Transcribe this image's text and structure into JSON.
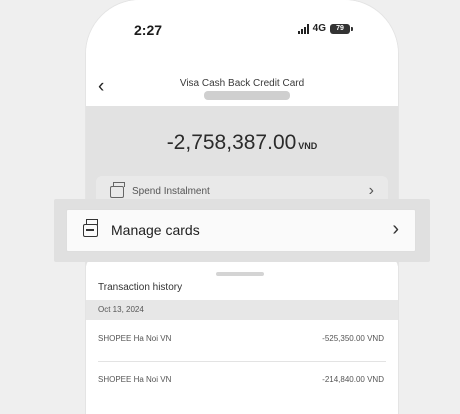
{
  "status_bar": {
    "time": "2:27",
    "network": "4G",
    "battery": "79"
  },
  "header": {
    "back_icon": "chevron-left-icon",
    "title": "Visa Cash Back Credit Card"
  },
  "balance": {
    "amount": "-2,758,387.00",
    "currency": "VND"
  },
  "spend_instalment": {
    "icon": "card-stack-icon",
    "label": "Spend Instalment"
  },
  "manage_cards": {
    "icon": "card-stack-icon",
    "label": "Manage cards"
  },
  "transactions": {
    "title": "Transaction history",
    "groups": [
      {
        "date": "Oct 13, 2024",
        "items": [
          {
            "merchant": "SHOPEE Ha Noi VN",
            "amount": "-525,350.00 VND"
          },
          {
            "merchant": "SHOPEE Ha Noi VN",
            "amount": "-214,840.00 VND"
          }
        ]
      }
    ]
  },
  "colors": {
    "overlay": "#e0e0e0",
    "summary_bg": "#e2e2e2",
    "text": "#222222"
  }
}
